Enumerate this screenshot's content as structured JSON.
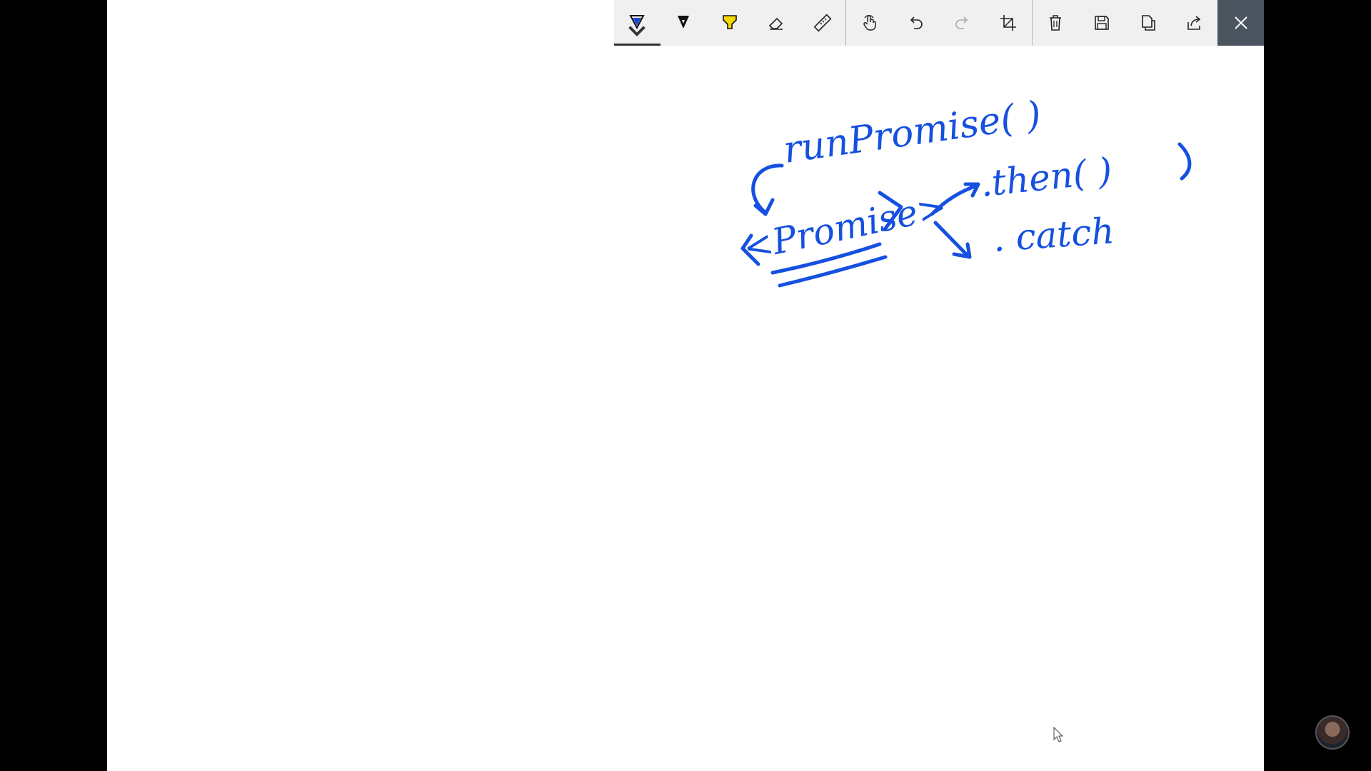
{
  "toolbar": {
    "tools": [
      {
        "name": "ballpoint-pen-icon",
        "active": true,
        "color": "#1a4ad6"
      },
      {
        "name": "pencil-icon",
        "active": false,
        "color": "#000000"
      },
      {
        "name": "highlighter-icon",
        "active": false,
        "color": "#f5d800"
      },
      {
        "name": "eraser-icon",
        "active": false
      },
      {
        "name": "ruler-icon",
        "active": false
      }
    ],
    "actions": [
      {
        "name": "touch-writing-icon"
      },
      {
        "name": "undo-icon"
      },
      {
        "name": "redo-icon",
        "disabled": true
      },
      {
        "name": "crop-icon"
      }
    ],
    "file_actions": [
      {
        "name": "delete-icon"
      },
      {
        "name": "save-icon"
      },
      {
        "name": "copy-icon"
      },
      {
        "name": "share-icon"
      }
    ],
    "close": {
      "name": "close-icon"
    }
  },
  "ink": {
    "color": "#1550e0",
    "handwriting": [
      "runPromise( )",
      "<Promise>",
      ".then(    )",
      ". catch"
    ]
  },
  "colors": {
    "toolbar_bg": "#f0f0f0",
    "close_bg": "#4a5560",
    "canvas": "#ffffff",
    "frame": "#000000"
  }
}
